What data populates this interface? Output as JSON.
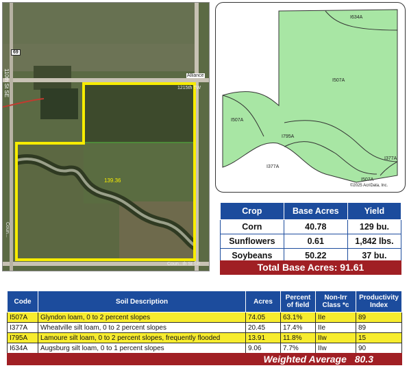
{
  "aerial": {
    "road_badge": "69",
    "road_label_left": "110th St SE",
    "road_label_alliance": "Alliance",
    "road_label_tw": "1215th TW",
    "field_acres": "139.36",
    "road_label_bottom": "Coun...th St SE",
    "road_label_left_bottom": "Coun...",
    "colors": {
      "boundary": "#f7ec00",
      "field": "#5f6a3e",
      "road": "#c8c2b4"
    }
  },
  "soil_map": {
    "labels": [
      "I634A",
      "I507A",
      "I507A",
      "I795A",
      "I377A",
      "I377A",
      "I507A"
    ],
    "copyright": "©2025 AcriData, Inc.",
    "colors": {
      "fill": "#a8e6a4",
      "line": "#333333"
    }
  },
  "crop_table": {
    "headers": [
      "Crop",
      "Base Acres",
      "Yield"
    ],
    "rows": [
      [
        "Corn",
        "40.78",
        "129 bu."
      ],
      [
        "Sunflowers",
        "0.61",
        "1,842 lbs."
      ],
      [
        "Soybeans",
        "50.22",
        "37 bu."
      ]
    ],
    "total": "Total Base Acres: 91.61"
  },
  "soil_table": {
    "headers": [
      "Code",
      "Soil Description",
      "Acres",
      "Percent of field",
      "Non-Irr Class *c",
      "Productivity Index"
    ],
    "rows": [
      [
        "I507A",
        "Glyndon loam, 0 to 2 percent slopes",
        "74.05",
        "63.1%",
        "IIe",
        "89"
      ],
      [
        "I377A",
        "Wheatville silt loam, 0 to 2 percent slopes",
        "20.45",
        "17.4%",
        "IIe",
        "89"
      ],
      [
        "I795A",
        "Lamoure silt loam, 0 to 2 percent slopes, frequently flooded",
        "13.91",
        "11.8%",
        "IIw",
        "15"
      ],
      [
        "I634A",
        "Augsburg silt loam, 0 to 1 percent slopes",
        "9.06",
        "7.7%",
        "IIw",
        "90"
      ]
    ],
    "weighted_label": "Weighted Average",
    "weighted_value": "80.3"
  },
  "colors": {
    "header_blue": "#1c4c9d",
    "total_red": "#a01f24",
    "row_yellow": "#f7ec2e"
  }
}
